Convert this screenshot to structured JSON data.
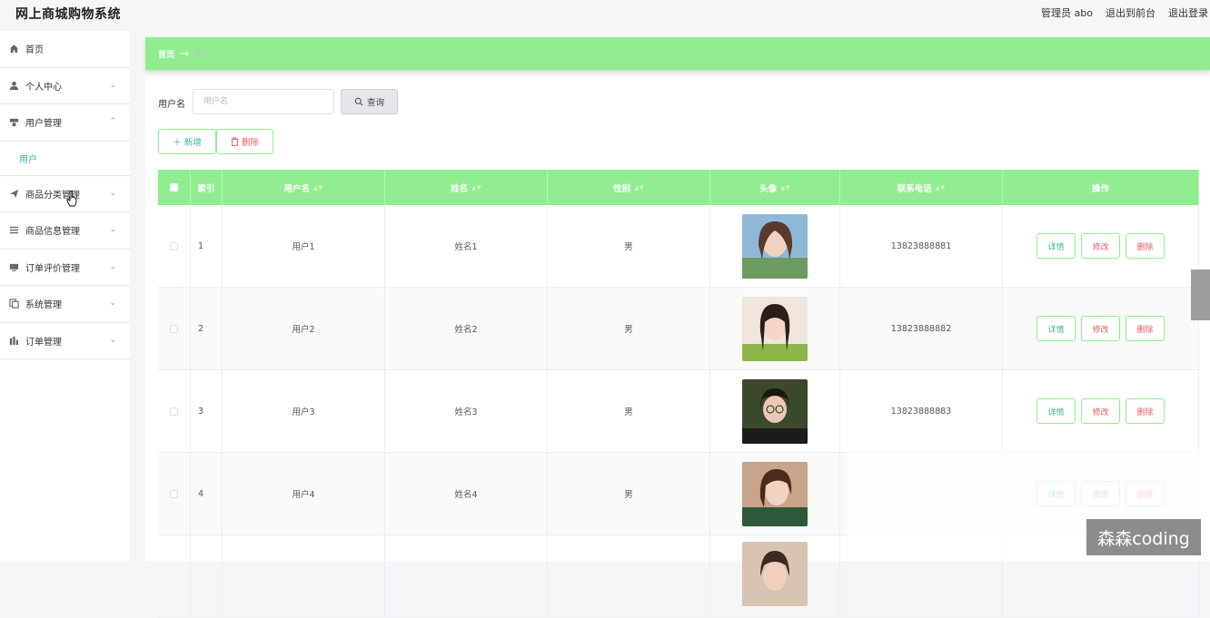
{
  "app": {
    "title": "网上商城购物系统"
  },
  "topbar": {
    "user": "管理员 abo",
    "to_front": "退出到前台",
    "logout": "退出登录"
  },
  "sidebar": {
    "items": [
      {
        "label": "首页",
        "icon": "home-icon",
        "chevron": ""
      },
      {
        "label": "个人中心",
        "icon": "user-icon",
        "chevron": "⌄"
      },
      {
        "label": "用户管理",
        "icon": "user-manage-icon",
        "chevron": "⌃"
      },
      {
        "label": "商品分类管理",
        "icon": "send-icon",
        "chevron": "⌄"
      },
      {
        "label": "商品信息管理",
        "icon": "list-icon",
        "chevron": "⌄"
      },
      {
        "label": "订单评价管理",
        "icon": "monitor-icon",
        "chevron": "⌄"
      },
      {
        "label": "系统管理",
        "icon": "copy-icon",
        "chevron": "⌄"
      },
      {
        "label": "订单管理",
        "icon": "chart-icon",
        "chevron": "⌄"
      }
    ],
    "submenu": {
      "label": "用户"
    }
  },
  "breadcrumb": {
    "home": "首页",
    "arrow": "→",
    "current": "用户"
  },
  "search": {
    "label": "用户名",
    "placeholder": "用户名",
    "button": "查询"
  },
  "actions": {
    "add": "新增",
    "delete": "删除"
  },
  "table": {
    "headers": [
      "索引",
      "用户名",
      "姓名",
      "性别",
      "头像",
      "联系电话",
      "操作"
    ],
    "rows": [
      {
        "index": "1",
        "username": "用户1",
        "name": "姓名1",
        "gender": "男",
        "phone": "13823888881"
      },
      {
        "index": "2",
        "username": "用户2",
        "name": "姓名2",
        "gender": "男",
        "phone": "13823888882"
      },
      {
        "index": "3",
        "username": "用户3",
        "name": "姓名3",
        "gender": "男",
        "phone": "13823888883"
      },
      {
        "index": "4",
        "username": "用户4",
        "name": "姓名4",
        "gender": "男",
        "phone": ""
      },
      {
        "index": "",
        "username": "",
        "name": "",
        "gender": "",
        "phone": ""
      }
    ],
    "ops": {
      "detail": "详情",
      "edit": "修改",
      "remove": "删除"
    }
  },
  "watermark": "森森coding",
  "colors": {
    "accent": "#90ee90",
    "teal": "#3bb3a0",
    "danger": "#e85c5c"
  }
}
